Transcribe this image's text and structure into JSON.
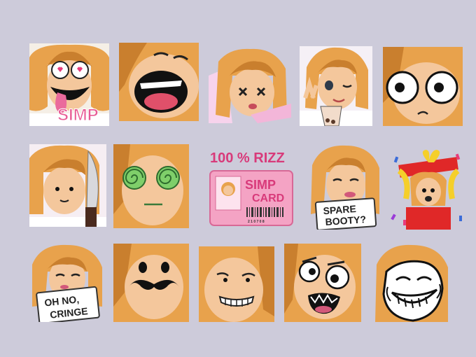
{
  "emotes": [
    {
      "id": "simp",
      "text": "SIMP"
    },
    {
      "id": "scream",
      "text": ""
    },
    {
      "id": "dizzy",
      "text": ""
    },
    {
      "id": "wink-boba",
      "text": ""
    },
    {
      "id": "big-eyes",
      "text": ""
    },
    {
      "id": "knife",
      "text": ""
    },
    {
      "id": "hypno",
      "text": ""
    },
    {
      "id": "simp-card",
      "title": "100 % RIZZ",
      "card_line1": "SIMP",
      "card_line2": "CARD",
      "serial": "2 1 0 7 0 8"
    },
    {
      "id": "spare-booty",
      "line1": "SPARE",
      "line2": "BOOTY?"
    },
    {
      "id": "gift-box",
      "text": ""
    },
    {
      "id": "oh-no-cringe",
      "line1": "OH NO,",
      "line2": "CRINGE"
    },
    {
      "id": "mustache",
      "text": ""
    },
    {
      "id": "grimace",
      "text": ""
    },
    {
      "id": "crazy-eyes",
      "text": ""
    },
    {
      "id": "troll",
      "text": ""
    }
  ],
  "colors": {
    "background": "#cdcbda",
    "hair": "#e8a24c",
    "hair_shade": "#c97f2e",
    "skin": "#f4c79c",
    "pink": "#f07fb0",
    "card_pink": "#f4a3c4"
  }
}
